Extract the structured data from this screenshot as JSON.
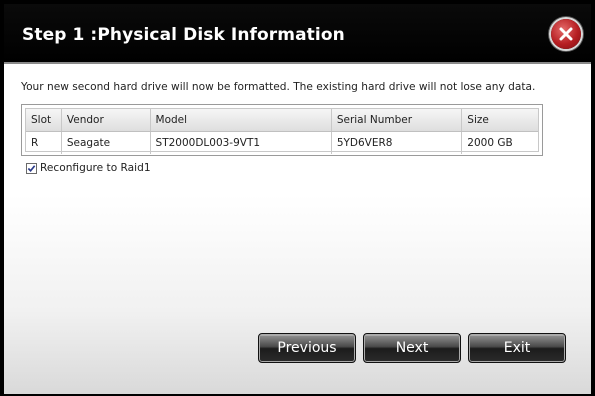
{
  "dialog": {
    "title": "Step 1 :Physical Disk Information",
    "info": "Your new second hard drive will now be formatted. The existing hard drive will not lose any data."
  },
  "table": {
    "headers": [
      "Slot",
      "Vendor",
      "Model",
      "Serial Number",
      "Size"
    ],
    "rows": [
      [
        "R",
        "Seagate",
        "ST2000DL003-9VT1",
        "5YD6VER8",
        "2000 GB"
      ]
    ]
  },
  "options": {
    "reconfigure_label": "Reconfigure to Raid1",
    "reconfigure_checked": true
  },
  "buttons": {
    "previous": "Previous",
    "next": "Next",
    "exit": "Exit"
  },
  "icons": {
    "close": "close-icon",
    "check": "checkmark-icon"
  },
  "colors": {
    "titlebar": "#000000",
    "close_button": "#b61e22",
    "button_dark": "#1c1c1c"
  }
}
